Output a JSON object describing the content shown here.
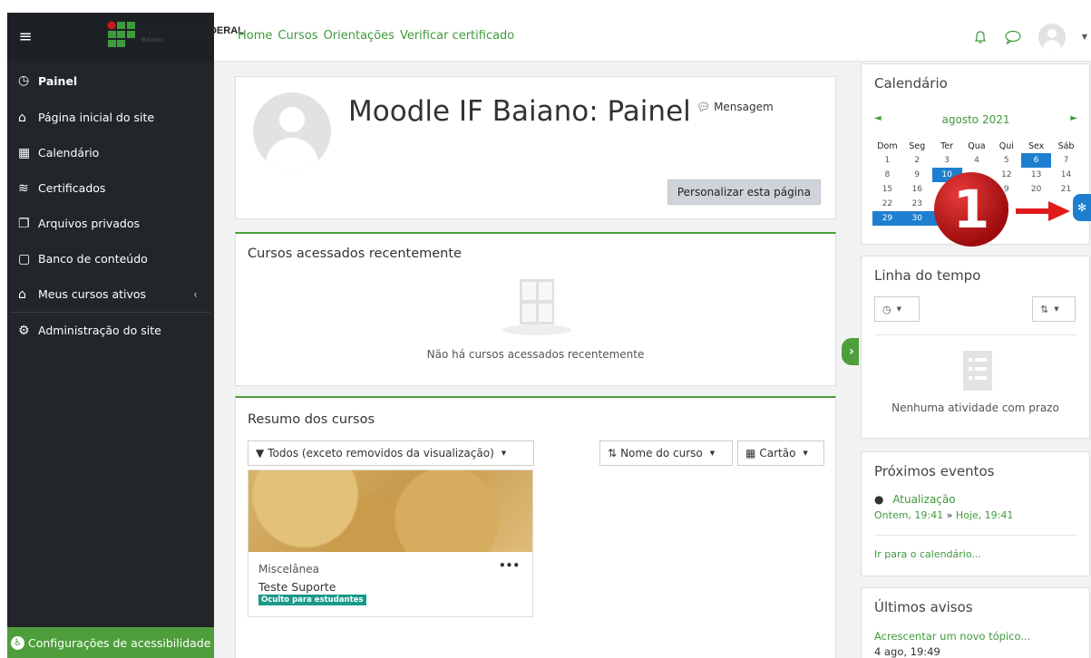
{
  "navbar": {
    "brand_name": "INSTITUTO FEDERAL",
    "brand_sub": "Baiano",
    "links": [
      "Home",
      "Cursos",
      "Orientações",
      "Verificar certificado"
    ]
  },
  "sidebar": {
    "items": [
      {
        "label": "Painel",
        "icon": "gauge-icon"
      },
      {
        "label": "Página inicial do site",
        "icon": "home-icon"
      },
      {
        "label": "Calendário",
        "icon": "calendar-icon"
      },
      {
        "label": "Certificados",
        "icon": "layers-icon"
      },
      {
        "label": "Arquivos privados",
        "icon": "files-icon"
      },
      {
        "label": "Banco de conteúdo",
        "icon": "clipboard-icon"
      },
      {
        "label": "Meus cursos ativos",
        "icon": "graduation-cap-icon"
      },
      {
        "label": "Administração do site",
        "icon": "gear-icon"
      }
    ],
    "accessibility": "Configurações de acessibilidade"
  },
  "header": {
    "title": "Moodle IF Baiano: Painel",
    "message_link": "Mensagem",
    "customize_button": "Personalizar esta página"
  },
  "recent": {
    "title": "Cursos acessados recentemente",
    "empty": "Não há cursos acessados recentemente"
  },
  "summary": {
    "title": "Resumo dos cursos",
    "filter": "Todos (exceto removidos da visualização)",
    "sort": "Nome do curso",
    "view": "Cartão",
    "course": {
      "category": "Miscelânea",
      "name": "Teste Suporte",
      "badge": "Oculto para estudantes",
      "menu": "•••"
    }
  },
  "calendar": {
    "title": "Calendário",
    "month": "agosto 2021",
    "prev": "◄",
    "next": "►",
    "weekdays": [
      "Dom",
      "Seg",
      "Ter",
      "Qua",
      "Qui",
      "Sex",
      "Sáb"
    ],
    "rows": [
      [
        "1",
        "2",
        "3",
        "4",
        "5",
        "6",
        "7"
      ],
      [
        "8",
        "9",
        "10",
        "",
        "12",
        "13",
        "14"
      ],
      [
        "15",
        "16",
        "",
        "",
        "9",
        "20",
        "21"
      ],
      [
        "22",
        "23",
        "",
        "",
        "6",
        "",
        ""
      ],
      [
        "29",
        "30",
        "",
        "",
        "",
        "",
        ""
      ]
    ],
    "marker": "1"
  },
  "timeline": {
    "title": "Linha do tempo",
    "empty": "Nenhuma atividade com prazo"
  },
  "events": {
    "title": "Próximos eventos",
    "event_name": "Atualização",
    "event_start": "Ontem, 19:41",
    "event_sep": " » ",
    "event_end": "Hoje, 19:41",
    "calendar_link": "Ir para o calendário..."
  },
  "news": {
    "title": "Últimos avisos",
    "add_topic": "Acrescentar um novo tópico...",
    "date": "4 ago, 19:49"
  },
  "colors": {
    "accent": "#3f9a3c",
    "sidebar_bg": "#22262a",
    "calendar_highlight": "#1e7fd0",
    "badge": "#1a9a89"
  }
}
